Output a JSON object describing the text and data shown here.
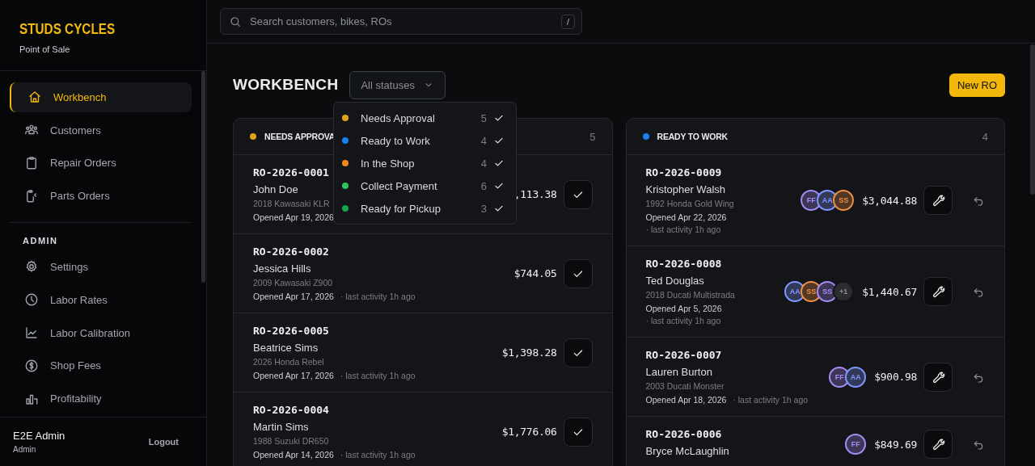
{
  "sidebar": {
    "brand": "STUDS CYCLES",
    "subtitle": "Point of Sale",
    "nav": [
      {
        "label": "Workbench",
        "selected": true
      },
      {
        "label": "Customers",
        "selected": false
      },
      {
        "label": "Repair Orders",
        "selected": false
      },
      {
        "label": "Parts Orders",
        "selected": false
      }
    ],
    "section_title": "ADMIN",
    "admin_nav": [
      {
        "label": "Settings",
        "selected": false
      },
      {
        "label": "Labor Rates",
        "selected": false
      },
      {
        "label": "Labor Calibration",
        "selected": false
      },
      {
        "label": "Shop Fees",
        "selected": false
      },
      {
        "label": "Profitability",
        "selected": false
      }
    ],
    "user": {
      "name": "E2E Admin",
      "role": "Admin"
    },
    "logout": "Logout"
  },
  "search": {
    "placeholder": "Search customers, bikes, ROs",
    "shortcut": "/"
  },
  "page_title": "WORKBENCH",
  "status_filter": {
    "value": "All statuses",
    "expanded": true,
    "options": [
      {
        "label": "Needs Approval",
        "count": "5",
        "color": "#e0a21a",
        "checked": true
      },
      {
        "label": "Ready to Work",
        "count": "4",
        "color": "#1a7ff0",
        "checked": true
      },
      {
        "label": "In the Shop",
        "count": "4",
        "color": "#f08a1a",
        "checked": true
      },
      {
        "label": "Collect Payment",
        "count": "6",
        "color": "#2fc35a",
        "checked": true
      },
      {
        "label": "Ready for Pickup",
        "count": "3",
        "color": "#17a34a",
        "checked": true
      }
    ]
  },
  "new_button": "New RO",
  "columns": [
    {
      "title": "NEEDS APPROVA",
      "color": "#e0a21a",
      "count": "5",
      "kind": "approval",
      "rows": [
        {
          "ro": "RO-2026-0001",
          "customer": "John Doe",
          "bike": "2018 Kawasaki KLR",
          "opened": "Opened Apr 19, 2026",
          "total": ",113.38",
          "techs": []
        },
        {
          "ro": "RO-2026-0002",
          "customer": "Jessica Hills",
          "bike": "2009 Kawasaki Z900",
          "opened": "Opened Apr 17, 2026",
          "activity": "· last activity 1h ago",
          "total": "$744.05",
          "techs": []
        },
        {
          "ro": "RO-2026-0005",
          "customer": "Beatrice Sims",
          "bike": "2026 Honda Rebel",
          "opened": "Opened Apr 17, 2026",
          "activity": "· last activity 1h ago",
          "total": "$1,398.28",
          "techs": []
        },
        {
          "ro": "RO-2026-0004",
          "customer": "Martin Sims",
          "bike": "1988 Suzuki DR650",
          "opened": "Opened Apr 14, 2026",
          "activity": "· last activity 1h ago",
          "total": "$1,776.06",
          "techs": []
        }
      ]
    },
    {
      "title": "READY TO WORK",
      "color": "#1a7ff0",
      "count": "4",
      "kind": "work",
      "rows": [
        {
          "ro": "RO-2026-0009",
          "customer": "Kristopher Walsh",
          "bike": "1992 Honda Gold Wing",
          "opened": "Opened Apr 22, 2026",
          "activity": "· last activity 1h ago",
          "total": "$3,044.88",
          "techs": [
            {
              "initials": "FF",
              "color": "#a68cf5"
            },
            {
              "initials": "AA",
              "color": "#7f97ff"
            },
            {
              "initials": "SS",
              "color": "#f08f45"
            }
          ]
        },
        {
          "ro": "RO-2026-0008",
          "customer": "Ted Douglas",
          "bike": "2018 Ducati Multistrada",
          "opened": "Opened Apr 5, 2026",
          "activity": "· last activity 1h ago",
          "total": "$1,440.67",
          "techs": [
            {
              "initials": "AA",
              "color": "#7f97ff"
            },
            {
              "initials": "SS",
              "color": "#f08f45"
            },
            {
              "initials": "SS",
              "color": "#a68cf5"
            }
          ],
          "extra": "+1"
        },
        {
          "ro": "RO-2026-0007",
          "customer": "Lauren Burton",
          "bike": "2003 Ducati Monster",
          "opened": "Opened Apr 18, 2026",
          "activity": "· last activity 1h ago",
          "total": "$900.98",
          "techs": [
            {
              "initials": "FF",
              "color": "#a68cf5"
            },
            {
              "initials": "AA",
              "color": "#7f97ff"
            }
          ]
        },
        {
          "ro": "RO-2026-0006",
          "customer": "Bryce McLaughlin",
          "total": "$849.69",
          "techs": [
            {
              "initials": "FF",
              "color": "#a68cf5"
            }
          ]
        }
      ]
    }
  ]
}
